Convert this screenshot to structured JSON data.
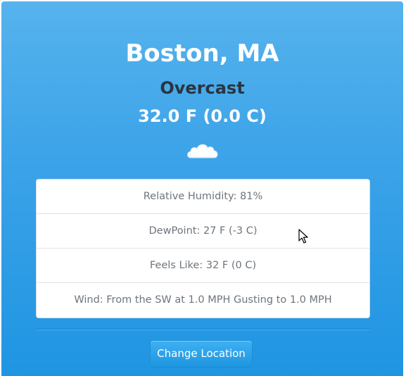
{
  "weather": {
    "location": "Boston, MA",
    "condition": "Overcast",
    "temperature": "32.0 F (0.0 C)",
    "icon": "cloud-icon"
  },
  "details": [
    {
      "text": "Relative Humidity: 81%"
    },
    {
      "text": "DewPoint: 27 F (-3 C)"
    },
    {
      "text": "Feels Like: 32 F (0 C)"
    },
    {
      "text": "Wind: From the SW at 1.0 MPH Gusting to 1.0 MPH"
    }
  ],
  "actions": {
    "change_location_label": "Change Location"
  },
  "colors": {
    "accent": "#2d9de6",
    "panel_text": "#6e757c",
    "condition_text": "#2b3440"
  }
}
